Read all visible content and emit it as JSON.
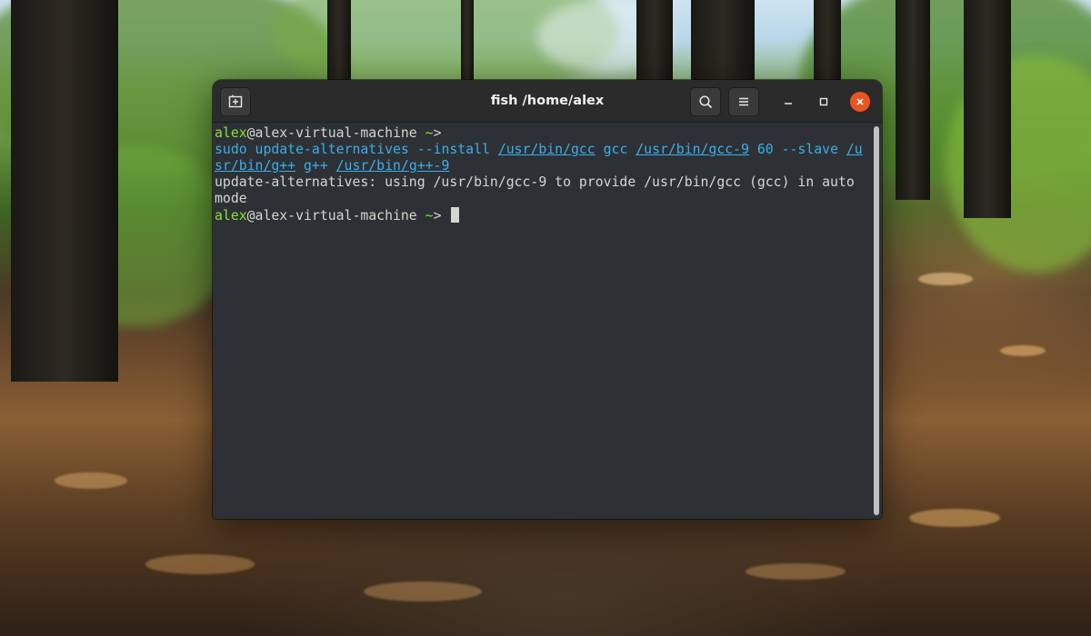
{
  "window": {
    "title": "fish /home/alex",
    "icons": {
      "new_tab": "new-tab-icon",
      "search": "search-icon",
      "menu": "hamburger-menu-icon",
      "minimize": "minimize-icon",
      "maximize": "maximize-icon",
      "close": "close-icon"
    },
    "colors": {
      "titlebar": "#2b2b2b",
      "terminal_bg": "#2d3135",
      "close_button": "#e95420",
      "prompt_user": "#8ae234",
      "command": "#3daee9",
      "output": "#d3d7cf"
    }
  },
  "terminal": {
    "line1": {
      "user": "alex",
      "host": "@alex-virtual-machine",
      "cwd": "~",
      "symbol": ">"
    },
    "line2": {
      "cmd": "sudo",
      "part1": " update-alternatives --install ",
      "path1": "/usr/bin/gcc",
      "part2": " gcc ",
      "path2": "/usr/bin/gcc-9",
      "part3": " 60 --slave ",
      "path3a": "/u"
    },
    "line3": {
      "path3b": "sr/bin/g++",
      "part4": " g++ ",
      "path4": "/usr/bin/g++-9"
    },
    "output1": "update-alternatives: using /usr/bin/gcc-9 to provide /usr/bin/gcc (gcc) in auto",
    "output2": "mode",
    "line6": {
      "user": "alex",
      "host": "@alex-virtual-machine",
      "cwd": "~",
      "symbol": ">"
    }
  }
}
